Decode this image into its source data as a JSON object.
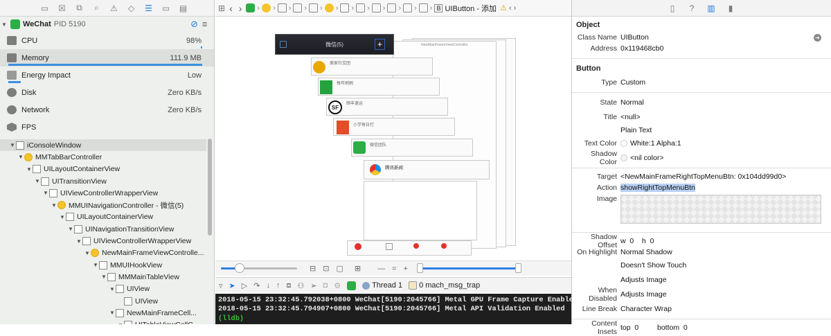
{
  "left": {
    "process": {
      "name": "WeChat",
      "pid": "PID 5190"
    },
    "gauges": [
      {
        "name": "CPU",
        "value": "98%",
        "bar": 0.02
      },
      {
        "name": "Memory",
        "value": "111.9 MB",
        "bar": 0.98
      },
      {
        "name": "Energy Impact",
        "value": "Low",
        "bar": 0.06
      },
      {
        "name": "Disk",
        "value": "Zero KB/s"
      },
      {
        "name": "Network",
        "value": "Zero KB/s"
      },
      {
        "name": "FPS",
        "value": ""
      }
    ],
    "tree": [
      {
        "label": "iConsoleWindow",
        "kind": "box",
        "selected": true
      },
      {
        "label": "MMTabBarController",
        "kind": "circle"
      },
      {
        "label": "UILayoutContainerView",
        "kind": "box"
      },
      {
        "label": "UITransitionView",
        "kind": "box"
      },
      {
        "label": "UIViewControllerWrapperView",
        "kind": "box"
      },
      {
        "label": "MMUINavigationController - 微信(5)",
        "kind": "circle"
      },
      {
        "label": "UILayoutContainerView",
        "kind": "box"
      },
      {
        "label": "UINavigationTransitionView",
        "kind": "box"
      },
      {
        "label": "UIViewControllerWrapperView",
        "kind": "box"
      },
      {
        "label": "NewMainFrameViewControlle...",
        "kind": "circle"
      },
      {
        "label": "MMUIHookView",
        "kind": "box"
      },
      {
        "label": "MMMainTableView",
        "kind": "box"
      },
      {
        "label": "UIView",
        "kind": "box"
      },
      {
        "label": "UIView",
        "kind": "box"
      },
      {
        "label": "NewMainFrameCell...",
        "kind": "box"
      },
      {
        "label": "UITableViewCellC...",
        "kind": "box"
      }
    ]
  },
  "center": {
    "jumpbar_last": "UIButton - 添加",
    "canvas_title": "微信(5)",
    "canvas_rows": [
      "美家社交团",
      "每年刷刷",
      "顺丰速运",
      "小学每日打",
      "微信团队",
      "腾讯新闻"
    ],
    "canvas_vc": "NewMainFrameViewController",
    "debug": {
      "thread": "Thread 1",
      "frame": "0 mach_msg_trap"
    },
    "console_lines": [
      "2018-05-15 23:32:45.792038+0800 WeChat[5190:2045766] Metal GPU Frame Capture Enabled",
      "2018-05-15 23:32:45.794907+0800 WeChat[5190:2045766] Metal API Validation Enabled"
    ],
    "console_prompt": "(lldb)"
  },
  "right": {
    "object_section": "Object",
    "object_rows": [
      {
        "label": "Class Name",
        "value": "UIButton"
      },
      {
        "label": "Address",
        "value": "0x119468cb0"
      }
    ],
    "button_section": "Button",
    "type": {
      "label": "Type",
      "value": "Custom"
    },
    "state": {
      "label": "State",
      "value": "Normal"
    },
    "title": {
      "label": "Title",
      "value": "<null>",
      "extra": "Plain Text"
    },
    "text_color": {
      "label": "Text Color",
      "value": "White:1 Alpha:1"
    },
    "shadow_color": {
      "label": "Shadow Color",
      "value": "<nil color>"
    },
    "target": {
      "label": "Target",
      "value": "<NewMainFrameRightTopMenuBtn: 0x104dd99d0>"
    },
    "action": {
      "label": "Action",
      "value": "showRightTopMenuBtn"
    },
    "image": {
      "label": "Image"
    },
    "shadow_offset": {
      "label": "Shadow Offset",
      "value": "w  0    h  0"
    },
    "on_highlight": {
      "label": "On Highlight",
      "values": [
        "Normal Shadow",
        "Doesn't Show Touch",
        "Adjusts Image"
      ]
    },
    "when_disabled": {
      "label": "When Disabled",
      "value": "Adjusts Image"
    },
    "line_break": {
      "label": "Line Break",
      "value": "Character Wrap"
    },
    "content_insets": {
      "label": "Content Insets",
      "top": "top  0",
      "bottom": "bottom  0"
    }
  },
  "colors": {
    "accent": "#1f7ae0",
    "wechat": "#2aae45",
    "console_bg": "#1e1e1e"
  }
}
